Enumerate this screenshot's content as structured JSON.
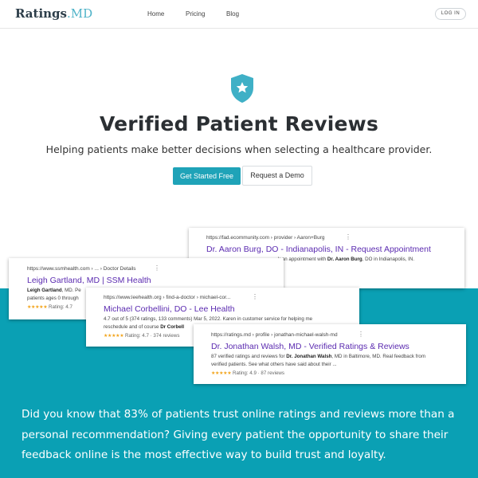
{
  "header": {
    "logo_main": "Ratings",
    "logo_tld": ".MD",
    "nav": {
      "home": "Home",
      "pricing": "Pricing",
      "blog": "Blog"
    },
    "login": "LOG IN"
  },
  "hero": {
    "title": "Verified Patient Reviews",
    "subtitle": "Helping patients make better decisions when selecting a healthcare provider.",
    "primary_cta": "Get Started Free",
    "secondary_cta": "Request a Demo"
  },
  "results": {
    "fad": {
      "url": "https://fad.ecommunity.com › provider › Aaron+Burg",
      "title": "Dr. Aaron Burg, DO - Indianapolis, IN - Request Appointment",
      "snippet_pre": "k an appointment with ",
      "snippet_bold": "Dr. Aaron Burg",
      "snippet_post": ", DO in Indianapolis, IN."
    },
    "ssm": {
      "url": "https://www.ssmhealth.com › ... › Doctor Details",
      "title": "Leigh Gartland, MD | SSM Health",
      "snippet_bold": "Leigh Gartland",
      "snippet_post": ", MD. Pe",
      "snippet_line2": "patients ages 0 through",
      "stars": "★★★★★",
      "rating": "Rating: 4.7"
    },
    "lee": {
      "url": "https://www.leehealth.org › find-a-doctor › michael-cor...",
      "title": "Michael Corbellini, DO - Lee Health",
      "snippet_line1": "4.7 out of 5 (374 ratings, 133 comments)  Mar 5, 2022. Karen in customer service for helping me",
      "snippet_line2_pre": "reschedule and of course ",
      "snippet_line2_bold": "Dr Corbell",
      "stars": "★★★★★",
      "rating": "Rating: 4.7 · 374 reviews"
    },
    "ratingsmd": {
      "url": "https://ratings.md › profile › jonathan-michael-walsh-md",
      "title": "Dr. Jonathan Walsh, MD - Verified Ratings & Reviews",
      "snippet_pre": "87 verified ratings and reviews for ",
      "snippet_bold": "Dr. Jonathan Walsh",
      "snippet_post": ", MD in Baltimore, MD. Real feedback from",
      "snippet_line2": "verified patients. See what others have said about their ...",
      "stars": "★★★★★",
      "rating": "Rating: 4.9 · 87 reviews"
    }
  },
  "band": {
    "text": "Did you know that 83% of patients trust online ratings and reviews more than a personal recommendation? Giving every patient the opportunity to share their feedback online is the most effective way to build trust and loyalty."
  },
  "colors": {
    "accent": "#1fa3b8",
    "band": "#0aa0b4",
    "link_title": "#5b2bb0",
    "star": "#f2a41b"
  },
  "icons": {
    "hero": "shield-star-icon",
    "menu": "more-vertical-icon"
  }
}
